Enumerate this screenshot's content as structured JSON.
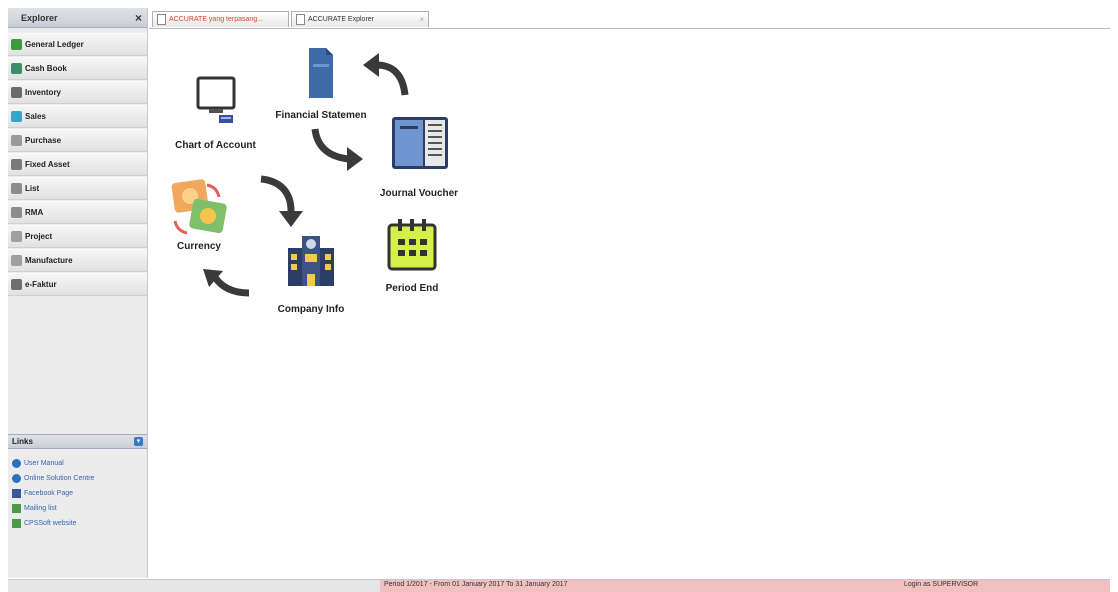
{
  "explorer": {
    "title": "Explorer",
    "close": "×",
    "items": [
      {
        "label": "General Ledger",
        "icon": "general-ledger-icon",
        "color": "#3f9a3f"
      },
      {
        "label": "Cash Book",
        "icon": "cash-book-icon",
        "color": "#3e8e6b"
      },
      {
        "label": "Inventory",
        "icon": "inventory-icon",
        "color": "#6b6b6b"
      },
      {
        "label": "Sales",
        "icon": "sales-icon",
        "color": "#3aa3c8"
      },
      {
        "label": "Purchase",
        "icon": "purchase-icon",
        "color": "#9a9a9a"
      },
      {
        "label": "Fixed Asset",
        "icon": "fixed-asset-icon",
        "color": "#7a7a7a"
      },
      {
        "label": "List",
        "icon": "list-icon",
        "color": "#8c8c8c"
      },
      {
        "label": "RMA",
        "icon": "rma-icon",
        "color": "#8c8c8c"
      },
      {
        "label": "Project",
        "icon": "project-icon",
        "color": "#a0a0a0"
      },
      {
        "label": "Manufacture",
        "icon": "manufacture-icon",
        "color": "#a0a0a0"
      },
      {
        "label": "e-Faktur",
        "icon": "e-faktur-icon",
        "color": "#6f6f6f"
      }
    ]
  },
  "links": {
    "title": "Links",
    "toggle": "▾",
    "items": [
      {
        "label": "User Manual",
        "icon": "help-icon",
        "color": "#2f6fc0"
      },
      {
        "label": "Online Solution Centre",
        "icon": "help-icon",
        "color": "#2f6fc0"
      },
      {
        "label": "Facebook Page",
        "icon": "facebook-icon",
        "color": "#3b5998"
      },
      {
        "label": "Mailing list",
        "icon": "mailing-list-icon",
        "color": "#4a9a4a"
      },
      {
        "label": "CPSSoft website",
        "icon": "website-icon",
        "color": "#4a9a4a"
      }
    ]
  },
  "tabs": [
    {
      "label": "ACCURATE yang terpasang...",
      "icon": "document-icon",
      "close": ""
    },
    {
      "label": "ACCURATE Explorer",
      "icon": "document-icon",
      "close": "×"
    }
  ],
  "workspace": {
    "nodes": {
      "chart_of_account": "Chart of Account",
      "financial_statement": "Financial Statemen",
      "journal_voucher": "Journal Voucher",
      "currency": "Currency",
      "company_info": "Company Info",
      "period_end": "Period End"
    }
  },
  "status": {
    "period": "Period 1/2017 - From 01 January 2017 To 31 January 2017",
    "user": "Login as SUPERVISOR",
    "period_bg": "#f2c0c0"
  }
}
